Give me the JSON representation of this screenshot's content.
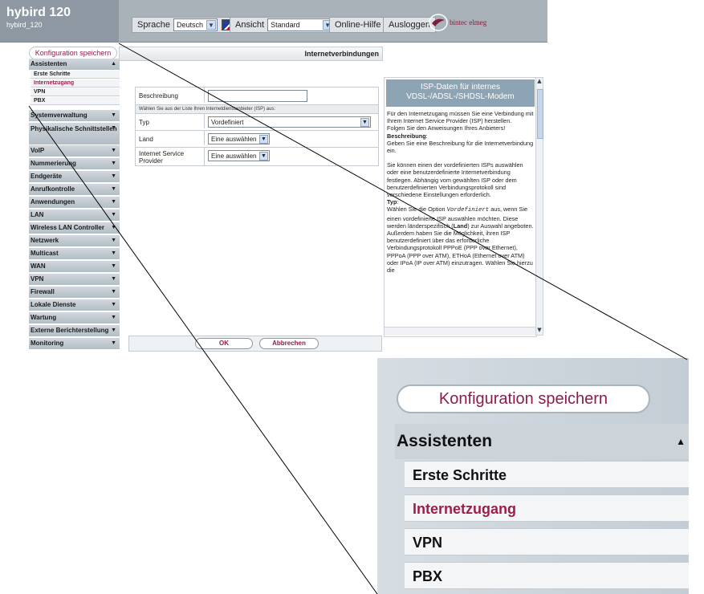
{
  "brand": {
    "title": "hybird 120",
    "subtitle": "hybird_120"
  },
  "toolbar": {
    "language_label": "Sprache",
    "language_value": "Deutsch",
    "view_label": "Ansicht",
    "view_value": "Standard",
    "help_label": "Online-Hilfe",
    "logout_label": "Ausloggen",
    "logo_text": "bintec elmeg"
  },
  "sidebar": {
    "save_label": "Konfiguration speichern",
    "assistants": {
      "label": "Assistenten",
      "items": [
        "Erste Schritte",
        "Internetzugang",
        "VPN",
        "PBX"
      ],
      "active": "Internetzugang"
    },
    "sections": [
      "Systemverwaltung",
      "Physikalische Schnittstellen",
      "VoIP",
      "Nummerierung",
      "Endgeräte",
      "Anrufkontrolle",
      "Anwendungen",
      "LAN",
      "Wireless LAN Controller",
      "Netzwerk",
      "Multicast",
      "WAN",
      "VPN",
      "Firewall",
      "Lokale Dienste",
      "Wartung",
      "Externe Berichterstellung",
      "Monitoring"
    ]
  },
  "main": {
    "title": "Internetverbindungen",
    "description_label": "Beschreibung",
    "description_value": "",
    "isp_info": "Wählen Sie aus der Liste Ihren Internetdienstanbieter (ISP) aus:",
    "type_label": "Typ",
    "type_value": "Vordefiniert",
    "country_label": "Land",
    "country_value": "Eine auswählen",
    "isp_label": "Internet Service Provider",
    "isp_value": "Eine auswählen",
    "ok_label": "OK",
    "cancel_label": "Abbrechen"
  },
  "help": {
    "title": "ISP-Daten für internes VDSL-/ADSL-/SHDSL-Modem",
    "p1": "Für den Internetzugang müssen Sie eine Verbindung mit Ihrem Internet Service Provider (ISP) herstellen.",
    "p2": "Folgen Sie den Anweisungen Ihres Anbieters!",
    "h_desc": "Beschreibung",
    "p3": "Geben Sie eine Beschreibung für die Internetverbindung ein.",
    "p4": "Sie können einen der vordefinierten ISPs auswählen oder eine benutzerdefinierte Internetverbindung festlegen. Abhängig vom gewählten ISP oder dem benutzerdefinierten Verbindungsprotokoll sind verschiedene Einstellungen erforderlich.",
    "h_type": "Typ",
    "p5a": "Wählen Sie die Option",
    "p5_code": "Vordefiniert",
    "p5b": "aus, wenn Sie einen vordefinierte ISP auswählen möchten. Diese werden länderspezifisch (",
    "p5_bold": "Land",
    "p5c": ") zur Auswahl angeboten. Außerdem haben Sie die Möglichkeit, ihren ISP benutzerdefiniert über das erforderliche Verbindungsprotokoll PPPoE (PPP over Ethernet), PPPoA (PPP over ATM), ETHoA (Ethernet over ATM) oder IPoA (IP over ATM) einzutragen. Wählen Sie hierzu die"
  },
  "zoom": {
    "save_label": "Konfiguration speichern",
    "head_label": "Assistenten",
    "items": [
      "Erste Schritte",
      "Internetzugang",
      "VPN",
      "PBX"
    ]
  },
  "colors": {
    "accent": "#8b1d4a",
    "bar": "#a9b1b9",
    "help_head": "#8da4b5"
  }
}
